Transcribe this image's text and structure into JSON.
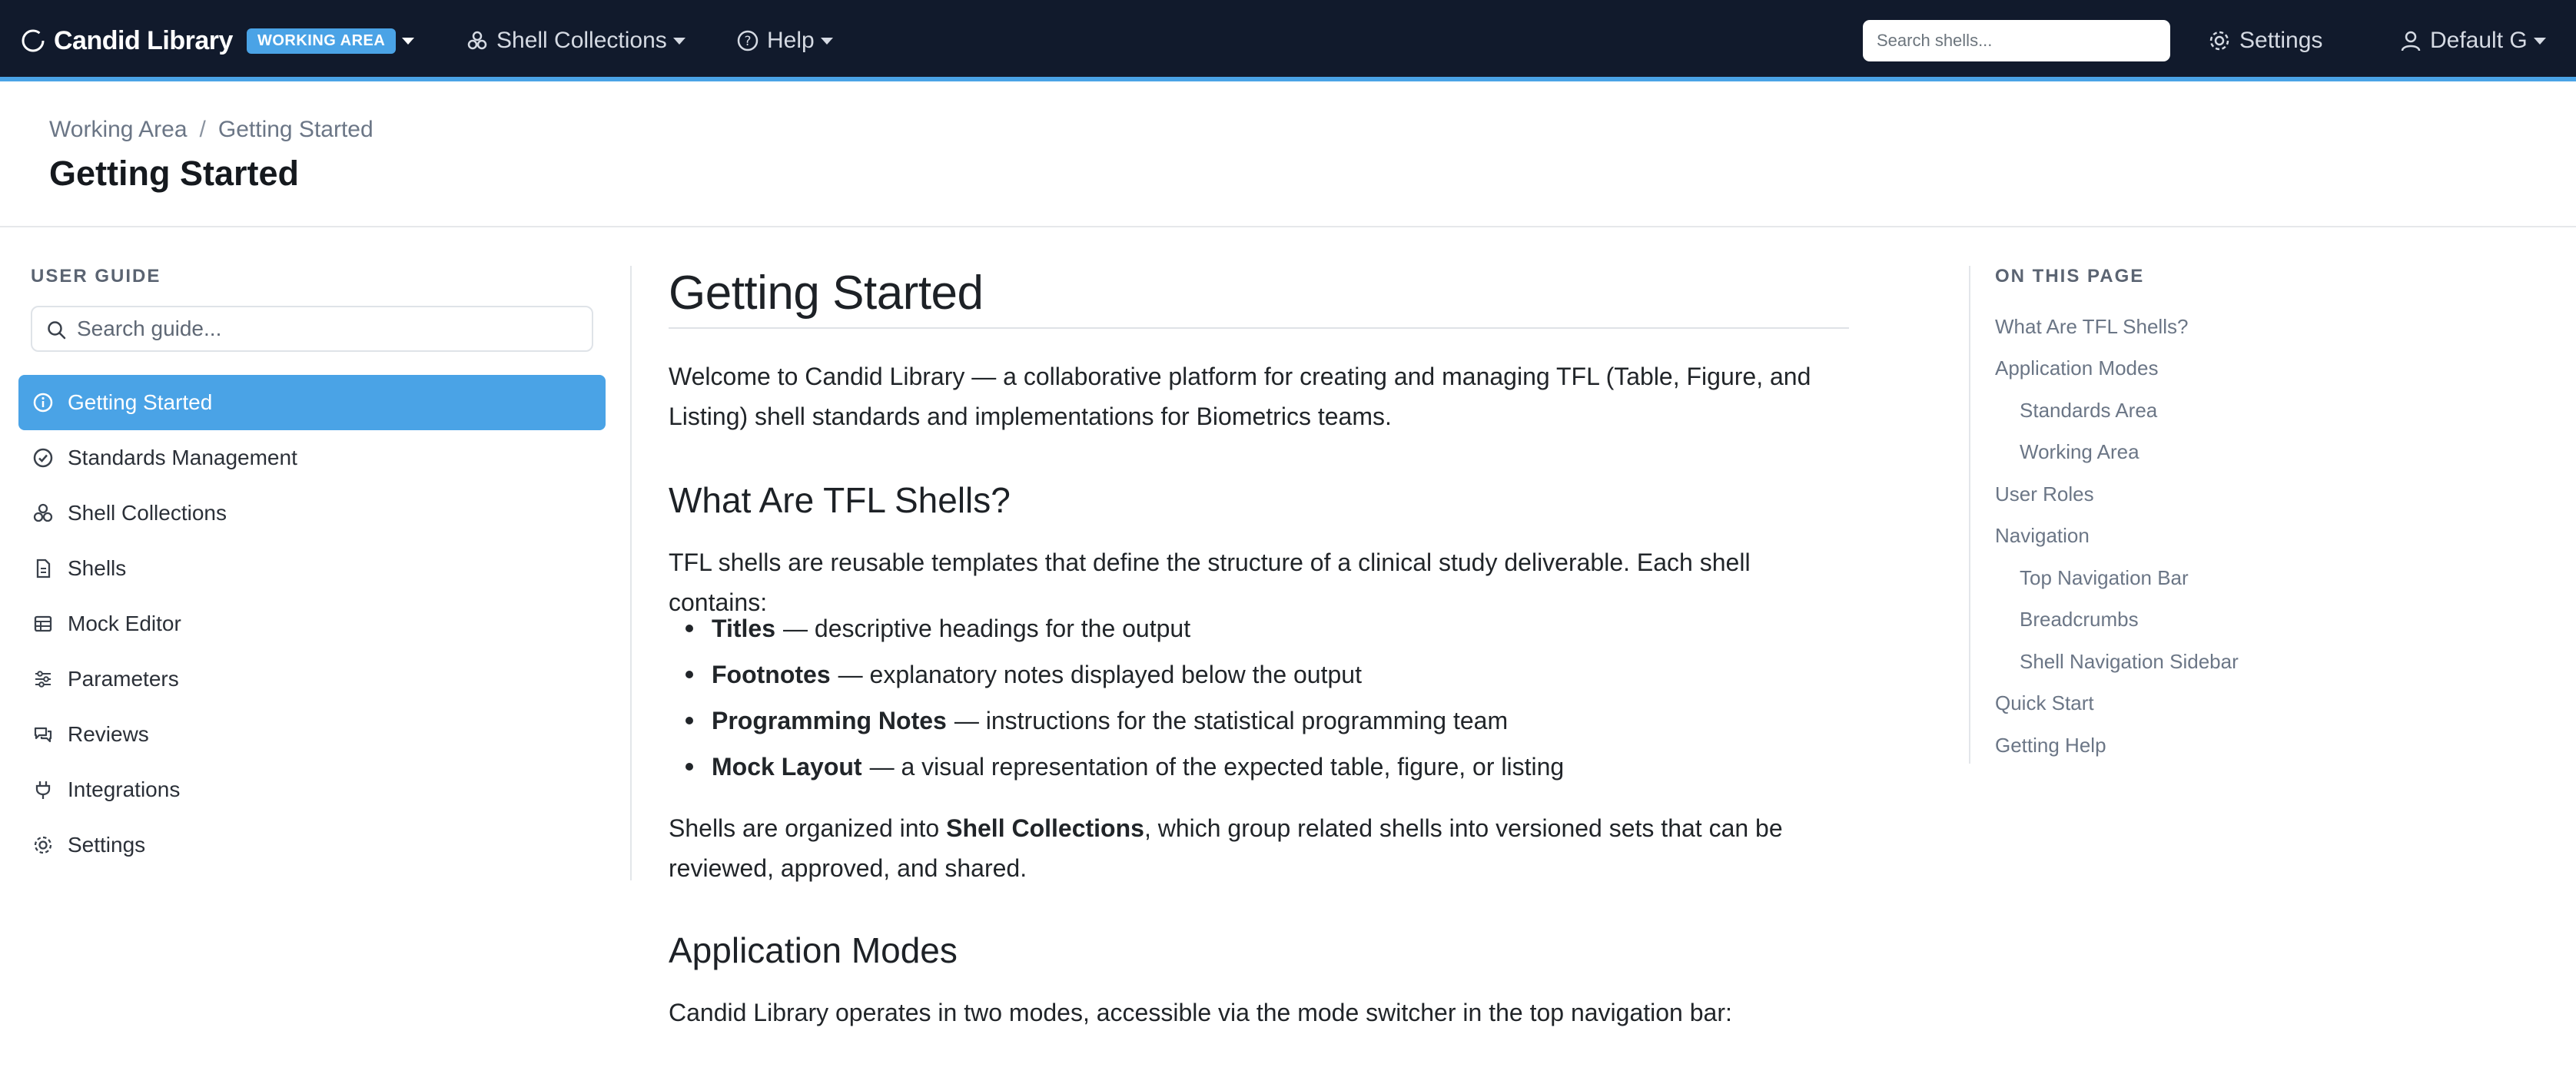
{
  "topnav": {
    "brand": "Candid Library",
    "mode_badge": "WORKING AREA",
    "collections_label": "Shell Collections",
    "help_label": "Help",
    "search_placeholder": "Search shells...",
    "settings_label": "Settings",
    "user_label": "Default G"
  },
  "header": {
    "breadcrumb": [
      "Working Area",
      "Getting Started"
    ],
    "title": "Getting Started"
  },
  "sidebar": {
    "heading": "USER GUIDE",
    "search_placeholder": "Search guide...",
    "items": [
      {
        "label": "Getting Started",
        "icon": "info-icon",
        "active": true
      },
      {
        "label": "Standards Management",
        "icon": "check-circle-icon"
      },
      {
        "label": "Shell Collections",
        "icon": "collections-icon"
      },
      {
        "label": "Shells",
        "icon": "document-icon"
      },
      {
        "label": "Mock Editor",
        "icon": "table-icon"
      },
      {
        "label": "Parameters",
        "icon": "sliders-icon"
      },
      {
        "label": "Reviews",
        "icon": "chat-icon"
      },
      {
        "label": "Integrations",
        "icon": "plug-icon"
      },
      {
        "label": "Settings",
        "icon": "gear-icon"
      }
    ]
  },
  "content": {
    "title": "Getting Started",
    "intro_line1": "Welcome to Candid Library — a collaborative platform for creating and managing TFL (Table, Figure, and",
    "intro_line2": "Listing) shell standards and implementations for Biometrics teams.",
    "section1_heading": "What Are TFL Shells?",
    "section1_text": "TFL shells are reusable templates that define the structure of a clinical study deliverable. Each shell contains:",
    "bullets": [
      {
        "term": "Titles",
        "desc": "— descriptive headings for the output"
      },
      {
        "term": "Footnotes",
        "desc": "— explanatory notes displayed below the output"
      },
      {
        "term": "Programming Notes",
        "desc": "— instructions for the statistical programming team"
      },
      {
        "term": "Mock Layout",
        "desc": "— a visual representation of the expected table, figure, or listing"
      }
    ],
    "organized_prefix": "Shells are organized into",
    "organized_bold": "Shell Collections",
    "organized_suffix": ", which group related shells into versioned sets that can be",
    "organized_line2": "reviewed, approved, and shared.",
    "section2_heading": "Application Modes",
    "section2_text": "Candid Library operates in two modes, accessible via the mode switcher in the top navigation bar:"
  },
  "toc": {
    "heading": "ON THIS PAGE",
    "items": [
      {
        "label": "What Are TFL Shells?",
        "level": 1
      },
      {
        "label": "Application Modes",
        "level": 1
      },
      {
        "label": "Standards Area",
        "level": 2
      },
      {
        "label": "Working Area",
        "level": 2
      },
      {
        "label": "User Roles",
        "level": 1
      },
      {
        "label": "Navigation",
        "level": 1
      },
      {
        "label": "Top Navigation Bar",
        "level": 2
      },
      {
        "label": "Breadcrumbs",
        "level": 2
      },
      {
        "label": "Shell Navigation Sidebar",
        "level": 2
      },
      {
        "label": "Quick Start",
        "level": 1
      },
      {
        "label": "Getting Help",
        "level": 1
      }
    ]
  },
  "colors": {
    "nav_bg": "#111a2c",
    "accent": "#4aa3e6",
    "muted_text": "#6b7686"
  }
}
